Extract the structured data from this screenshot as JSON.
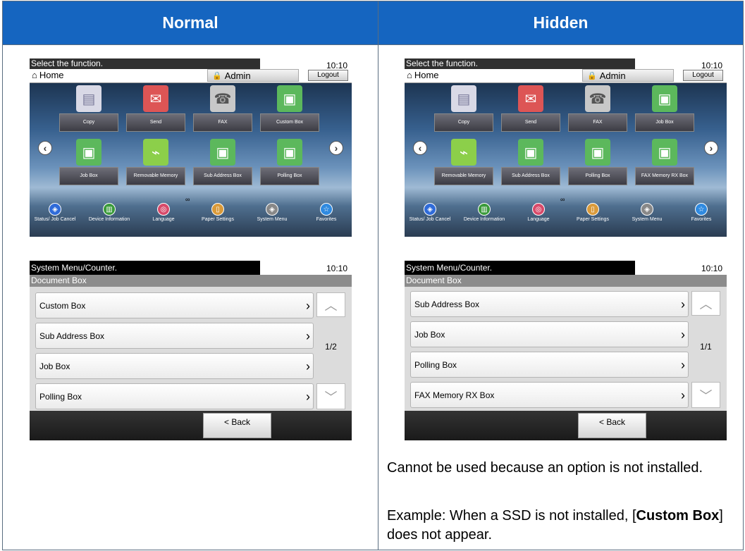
{
  "headers": {
    "normal": "Normal",
    "hidden": "Hidden"
  },
  "status": {
    "text": "Select the function.",
    "time": "10:10"
  },
  "home": {
    "label": "Home",
    "user": "Admin",
    "logout": "Logout"
  },
  "normal_tiles": [
    "Copy",
    "Send",
    "FAX",
    "Custom Box",
    "Job Box",
    "Removable Memory",
    "Sub Address Box",
    "Polling Box"
  ],
  "hidden_tiles": [
    "Copy",
    "Send",
    "FAX",
    "Job Box",
    "Removable Memory",
    "Sub Address Box",
    "Polling Box",
    "FAX Memory RX Box"
  ],
  "bottom_bar": [
    "Status/ Job Cancel",
    "Device Information",
    "Language",
    "Paper Settings",
    "System Menu",
    "Favorites"
  ],
  "menu": {
    "title": "System Menu/Counter.",
    "time": "10:10",
    "section": "Document Box",
    "normal_items": [
      "Custom Box",
      "Sub Address Box",
      "Job Box",
      "Polling Box"
    ],
    "normal_page": "1/2",
    "hidden_items": [
      "Sub Address Box",
      "Job Box",
      "Polling Box",
      "FAX Memory RX Box"
    ],
    "hidden_page": "1/1",
    "back": "< Back"
  },
  "note": {
    "line1": "Cannot be used because an option is not installed.",
    "line2_prefix": "Example: When a SSD is not installed, [",
    "line2_bold": "Custom Box",
    "line2_suffix": "] does not appear."
  },
  "colors": {
    "header_bg": "#1565c0",
    "border": "#5a6d80"
  }
}
